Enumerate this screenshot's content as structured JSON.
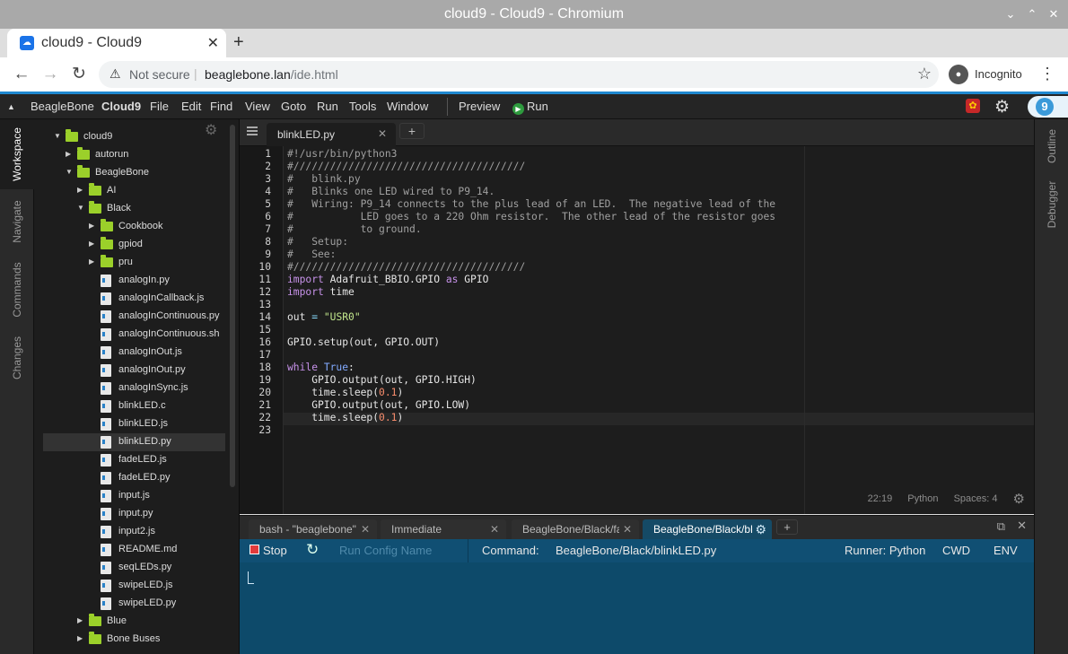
{
  "window": {
    "title": "cloud9 - Cloud9 - Chromium"
  },
  "browser": {
    "tab_title": "cloud9 - Cloud9",
    "security_text": "Not secure",
    "url_host": "beaglebone.lan",
    "url_path": "/ide.html",
    "incognito_label": "Incognito"
  },
  "menubar": {
    "items": [
      "BeagleBone",
      "Cloud9",
      "File",
      "Edit",
      "Find",
      "View",
      "Goto",
      "Run",
      "Tools",
      "Window"
    ],
    "preview": "Preview",
    "run": "Run"
  },
  "left_panels": [
    "Workspace",
    "Navigate",
    "Commands",
    "Changes"
  ],
  "right_panels": [
    "Outline",
    "Debugger"
  ],
  "tree": [
    {
      "name": "cloud9",
      "type": "folder",
      "depth": 0,
      "expanded": true
    },
    {
      "name": "autorun",
      "type": "folder",
      "depth": 1,
      "expanded": false
    },
    {
      "name": "BeagleBone",
      "type": "folder",
      "depth": 1,
      "expanded": true
    },
    {
      "name": "AI",
      "type": "folder",
      "depth": 2,
      "expanded": false
    },
    {
      "name": "Black",
      "type": "folder",
      "depth": 2,
      "expanded": true
    },
    {
      "name": "Cookbook",
      "type": "folder",
      "depth": 3,
      "expanded": false
    },
    {
      "name": "gpiod",
      "type": "folder",
      "depth": 3,
      "expanded": false
    },
    {
      "name": "pru",
      "type": "folder",
      "depth": 3,
      "expanded": false
    },
    {
      "name": "analogIn.py",
      "type": "file",
      "depth": 3
    },
    {
      "name": "analogInCallback.js",
      "type": "file",
      "depth": 3
    },
    {
      "name": "analogInContinuous.py",
      "type": "file",
      "depth": 3
    },
    {
      "name": "analogInContinuous.sh",
      "type": "file",
      "depth": 3
    },
    {
      "name": "analogInOut.js",
      "type": "file",
      "depth": 3
    },
    {
      "name": "analogInOut.py",
      "type": "file",
      "depth": 3
    },
    {
      "name": "analogInSync.js",
      "type": "file",
      "depth": 3
    },
    {
      "name": "blinkLED.c",
      "type": "file",
      "depth": 3
    },
    {
      "name": "blinkLED.js",
      "type": "file",
      "depth": 3
    },
    {
      "name": "blinkLED.py",
      "type": "file",
      "depth": 3,
      "selected": true
    },
    {
      "name": "fadeLED.js",
      "type": "file",
      "depth": 3
    },
    {
      "name": "fadeLED.py",
      "type": "file",
      "depth": 3
    },
    {
      "name": "input.js",
      "type": "file",
      "depth": 3
    },
    {
      "name": "input.py",
      "type": "file",
      "depth": 3
    },
    {
      "name": "input2.js",
      "type": "file",
      "depth": 3
    },
    {
      "name": "README.md",
      "type": "file",
      "depth": 3
    },
    {
      "name": "seqLEDs.py",
      "type": "file",
      "depth": 3
    },
    {
      "name": "swipeLED.js",
      "type": "file",
      "depth": 3
    },
    {
      "name": "swipeLED.py",
      "type": "file",
      "depth": 3
    },
    {
      "name": "Blue",
      "type": "folder",
      "depth": 2,
      "expanded": false
    },
    {
      "name": "Bone Buses",
      "type": "folder",
      "depth": 2,
      "expanded": false
    }
  ],
  "editor": {
    "tab": "blinkLED.py",
    "lines": [
      [
        [
          "cm",
          "#!/usr/bin/python3"
        ]
      ],
      [
        [
          "cm",
          "#//////////////////////////////////////"
        ]
      ],
      [
        [
          "cm",
          "#   blink.py"
        ]
      ],
      [
        [
          "cm",
          "#   Blinks one LED wired to P9_14."
        ]
      ],
      [
        [
          "cm",
          "#   Wiring: P9_14 connects to the plus lead of an LED.  The negative lead of the"
        ]
      ],
      [
        [
          "cm",
          "#           LED goes to a 220 Ohm resistor.  The other lead of the resistor goes"
        ]
      ],
      [
        [
          "cm",
          "#           to ground."
        ]
      ],
      [
        [
          "cm",
          "#   Setup:"
        ]
      ],
      [
        [
          "cm",
          "#   See:"
        ]
      ],
      [
        [
          "cm",
          "#//////////////////////////////////////"
        ]
      ],
      [
        [
          "kw",
          "import"
        ],
        [
          "tx",
          " Adafruit_BBIO.GPIO "
        ],
        [
          "kw",
          "as"
        ],
        [
          "tx",
          " GPIO"
        ]
      ],
      [
        [
          "kw",
          "import"
        ],
        [
          "tx",
          " time"
        ]
      ],
      [],
      [
        [
          "tx",
          "out "
        ],
        [
          "op",
          "="
        ],
        [
          "tx",
          " "
        ],
        [
          "st",
          "\"USR0\""
        ]
      ],
      [],
      [
        [
          "tx",
          "GPIO.setup(out, GPIO.OUT)"
        ]
      ],
      [],
      [
        [
          "kw",
          "while"
        ],
        [
          "tx",
          " "
        ],
        [
          "bi",
          "True"
        ],
        [
          "tx",
          ":"
        ]
      ],
      [
        [
          "tx",
          "    GPIO.output(out, GPIO.HIGH)"
        ]
      ],
      [
        [
          "tx",
          "    time.sleep("
        ],
        [
          "nm",
          "0.1"
        ],
        [
          "tx",
          ")"
        ]
      ],
      [
        [
          "tx",
          "    GPIO.output(out, GPIO.LOW)"
        ]
      ],
      [
        [
          "tx",
          "    time.sleep("
        ],
        [
          "nm",
          "0.1"
        ],
        [
          "tx",
          ")"
        ]
      ],
      []
    ],
    "status": {
      "position": "22:19",
      "language": "Python",
      "indent": "Spaces: 4"
    }
  },
  "console": {
    "tabs": [
      "bash - \"beaglebone\"",
      "Immediate",
      "BeagleBone/Black/fa",
      "BeagleBone/Black/bl"
    ],
    "stop": "Stop",
    "run_config_placeholder": "Run Config Name",
    "command_label": "Command:",
    "command_value": "BeagleBone/Black/blinkLED.py",
    "runner": "Runner: Python",
    "cwd": "CWD",
    "env": "ENV"
  }
}
